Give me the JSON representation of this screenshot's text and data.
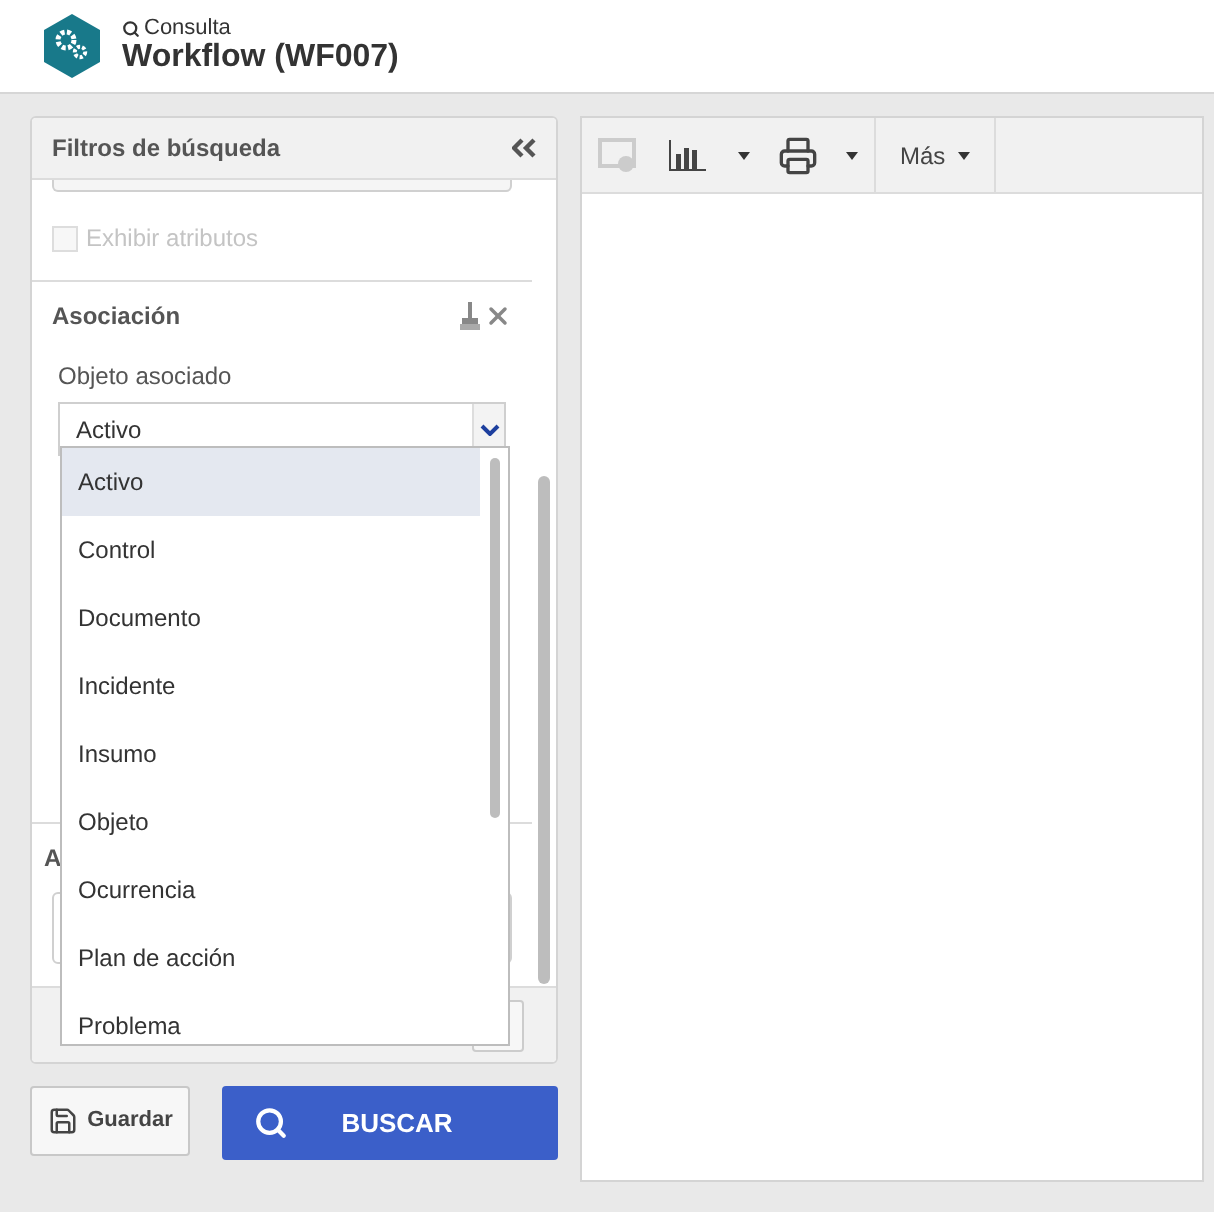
{
  "header": {
    "subtitle": "Consulta",
    "title": "Workflow (WF007)"
  },
  "filters": {
    "title": "Filtros de búsqueda",
    "show_attributes": {
      "label": "Exhibir atributos",
      "checked": false,
      "disabled": true
    },
    "association": {
      "title": "Asociación",
      "field_label": "Objeto asociado",
      "value": "Activo",
      "options": [
        {
          "label": "Activo",
          "selected": true
        },
        {
          "label": "Control",
          "selected": false
        },
        {
          "label": "Documento",
          "selected": false
        },
        {
          "label": "Incidente",
          "selected": false
        },
        {
          "label": "Insumo",
          "selected": false
        },
        {
          "label": "Objeto",
          "selected": false
        },
        {
          "label": "Ocurrencia",
          "selected": false
        },
        {
          "label": "Plan de acción",
          "selected": false
        },
        {
          "label": "Problema",
          "selected": false
        }
      ]
    },
    "next_section_title": "A"
  },
  "buttons": {
    "save": "Guardar",
    "search": "BUSCAR"
  },
  "toolbar": {
    "more": "Más"
  }
}
